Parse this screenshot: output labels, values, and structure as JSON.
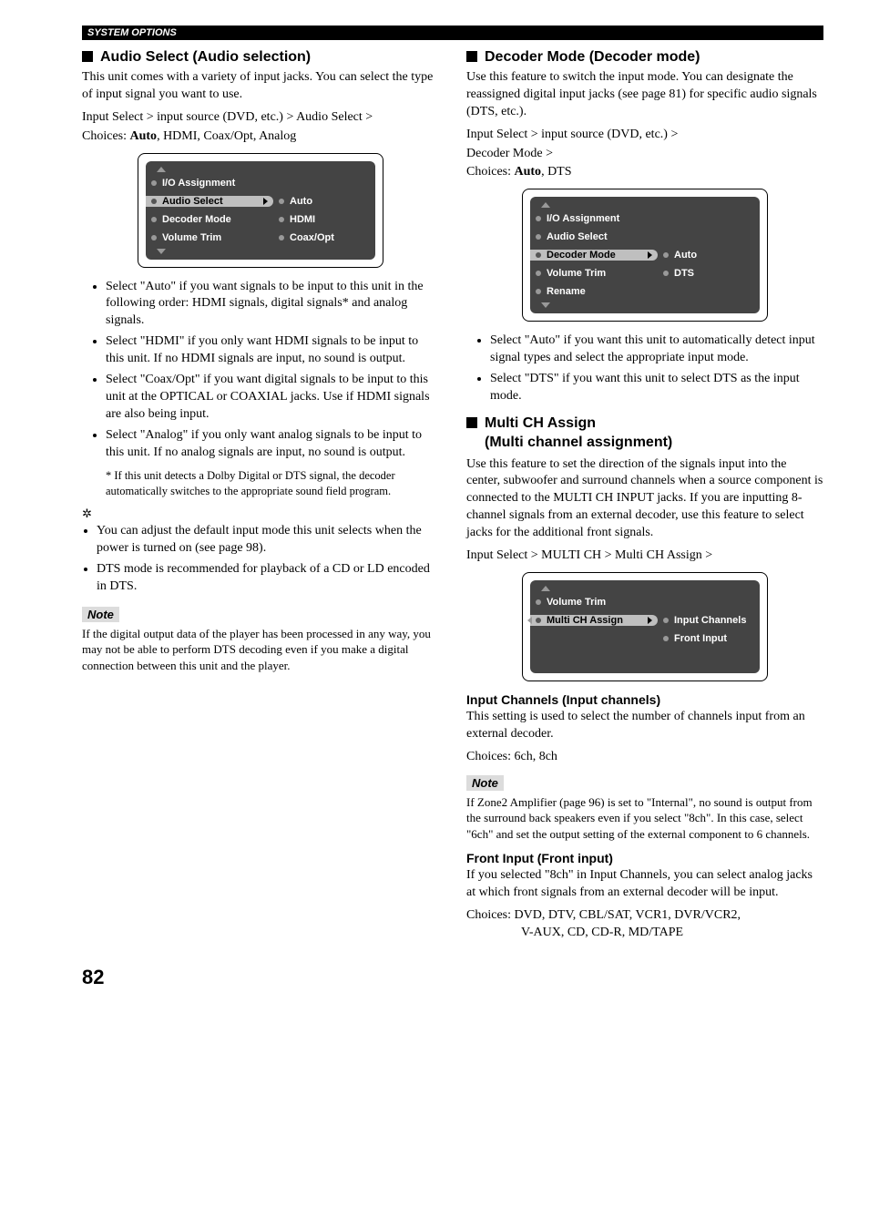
{
  "header": "SYSTEM OPTIONS",
  "left": {
    "sec1": {
      "title": "Audio Select (Audio selection)",
      "p1": "This unit comes with a variety of input jacks. You can select the type of input signal you want to use.",
      "path": "Input Select > input source (DVD, etc.) > Audio Select >",
      "choices_label": "Choices: ",
      "choices_bold": "Auto",
      "choices_rest": ", HDMI, Coax/Opt, Analog",
      "osd": {
        "items": [
          "I/O Assignment",
          "Audio Select",
          "Decoder Mode",
          "Volume Trim"
        ],
        "right": [
          "Auto",
          "HDMI",
          "Coax/Opt"
        ],
        "selectedIndex": 1
      },
      "bullets": [
        "Select \"Auto\" if you want signals to be input to this unit in the following order: HDMI signals, digital signals* and analog signals.",
        "Select \"HDMI\" if you only want HDMI signals to be input to this unit. If no HDMI signals are input, no sound is output.",
        "Select \"Coax/Opt\" if you want digital signals to be input to this unit at the OPTICAL or COAXIAL jacks. Use if HDMI signals are also being input.",
        "Select \"Analog\" if you only want analog signals to be input to this unit. If no analog signals are input, no sound is output."
      ],
      "footnote": "* If this unit detects a Dolby Digital or DTS signal, the decoder automatically switches to the appropriate sound field program.",
      "tips": [
        "You can adjust the default input mode this unit selects when the power is turned on (see page 98).",
        "DTS mode is recommended for playback of a CD or LD encoded in DTS."
      ],
      "note_label": "Note",
      "note_text": "If the digital output data of the player has been processed in any way, you may not be able to perform DTS decoding even if you make a digital connection between this unit and the player."
    }
  },
  "right": {
    "sec1": {
      "title": "Decoder Mode (Decoder mode)",
      "p1": "Use this feature to switch the input mode. You can designate the reassigned digital input jacks (see page 81) for specific audio signals (DTS, etc.).",
      "path1": "Input Select > input source (DVD, etc.) >",
      "path2": "Decoder Mode >",
      "choices_label": "Choices: ",
      "choices_bold": "Auto",
      "choices_rest": ", DTS",
      "osd": {
        "items": [
          "I/O Assignment",
          "Audio Select",
          "Decoder Mode",
          "Volume Trim",
          "Rename"
        ],
        "right": [
          "Auto",
          "DTS"
        ],
        "selectedIndex": 2
      },
      "bullets": [
        "Select \"Auto\" if you want this unit to automatically detect input signal types and select the appropriate input mode.",
        "Select \"DTS\" if you want this unit to select DTS as the input mode."
      ]
    },
    "sec2": {
      "title_l1": "Multi CH Assign",
      "title_l2": "(Multi channel assignment)",
      "p1": "Use this feature to set the direction of the signals input into the center, subwoofer and surround channels when a source component is connected to the MULTI CH INPUT jacks. If you are inputting 8-channel signals from an external decoder, use this feature to select jacks for the additional front signals.",
      "path": "Input Select > MULTI CH > Multi CH Assign >",
      "osd": {
        "items": [
          "Volume Trim",
          "Multi CH Assign"
        ],
        "right": [
          "Input Channels",
          "Front Input"
        ],
        "selectedIndex": 1,
        "showLeftArrow": true
      },
      "sub1_title": "Input Channels (Input channels)",
      "sub1_p": "This setting is used to select the number of channels input from an external decoder.",
      "sub1_choices": "Choices: 6ch, 8ch",
      "note_label": "Note",
      "note_text": "If Zone2 Amplifier (page 96) is set to \"Internal\", no sound is output from the surround back speakers even if you select \"8ch\". In this case, select \"6ch\" and set the output setting of the external component to 6 channels.",
      "sub2_title": "Front Input (Front input)",
      "sub2_p": "If you selected \"8ch\" in Input Channels, you can select analog jacks at which front signals from an external decoder will be input.",
      "sub2_choices_l1": "Choices: DVD, DTV, CBL/SAT, VCR1, DVR/VCR2,",
      "sub2_choices_l2": "V-AUX, CD, CD-R, MD/TAPE"
    }
  },
  "pageNumber": "82"
}
